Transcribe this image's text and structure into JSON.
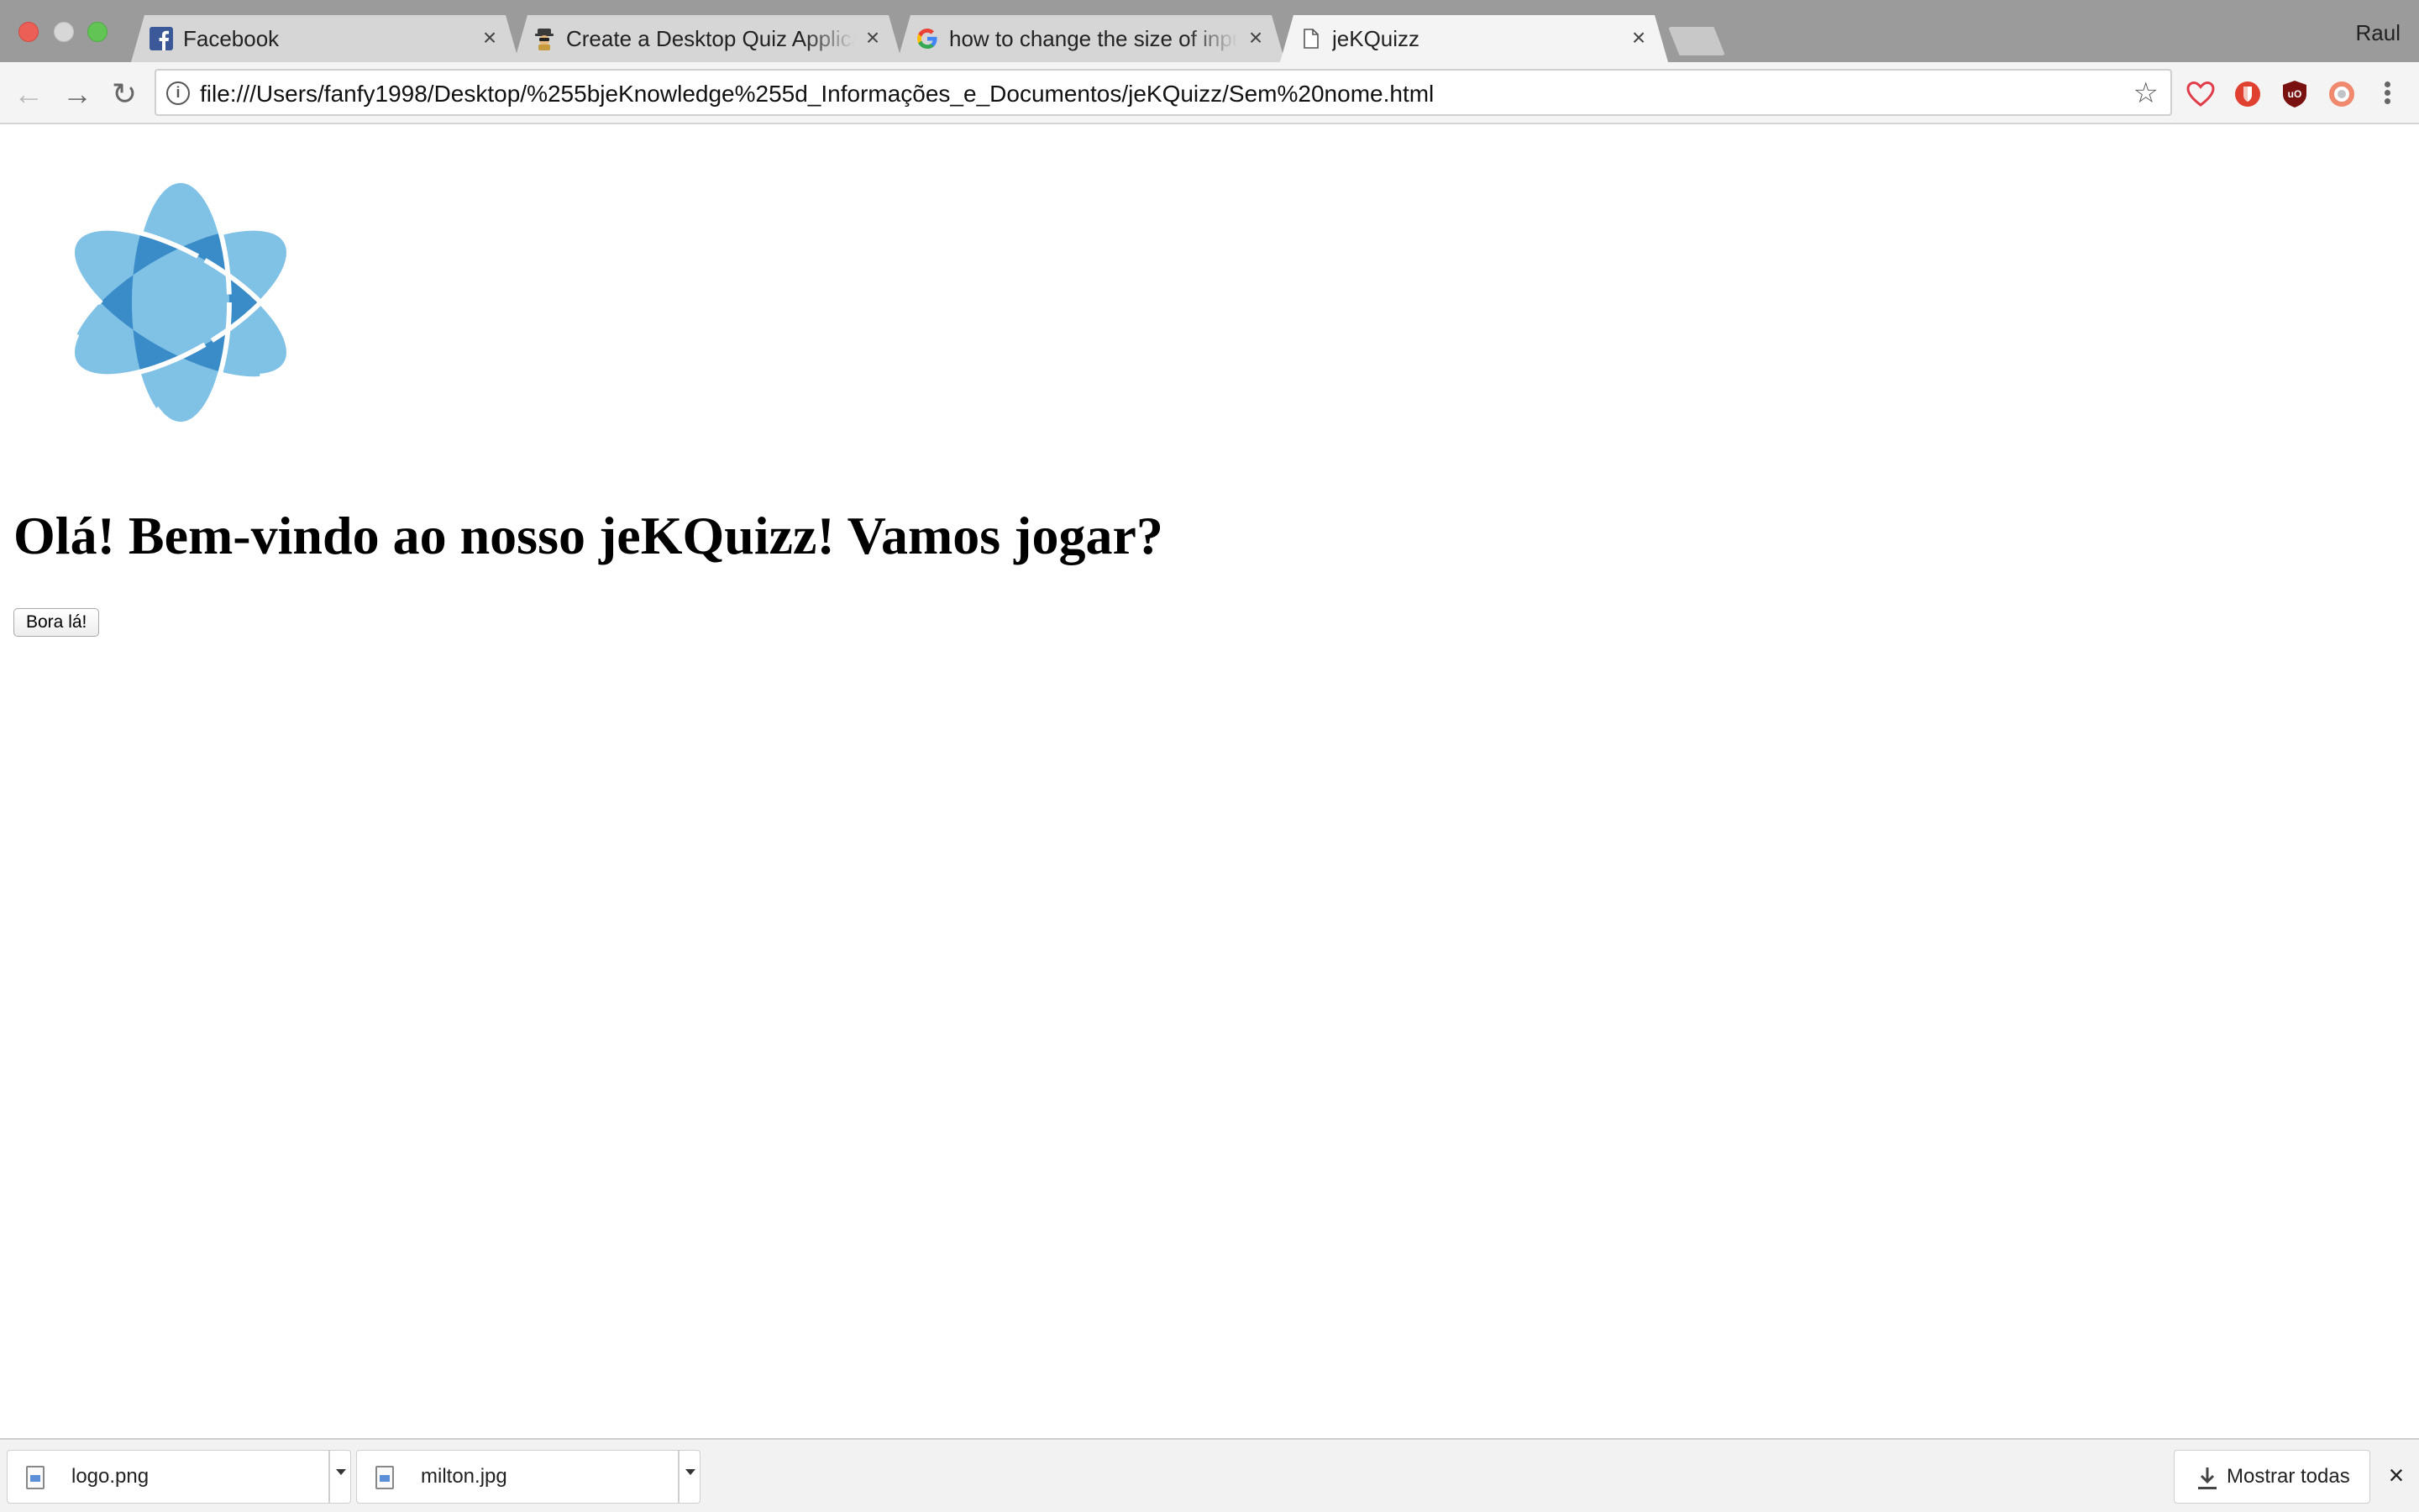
{
  "browser": {
    "profile_name": "Raul",
    "tabs": [
      {
        "title": "Facebook",
        "favicon": "facebook-icon",
        "active": false
      },
      {
        "title": "Create a Desktop Quiz Applica",
        "favicon": "spy-icon",
        "active": false
      },
      {
        "title": "how to change the size of inpu",
        "favicon": "google-icon",
        "active": false
      },
      {
        "title": "jeKQuizz",
        "favicon": "page-icon",
        "active": true
      }
    ],
    "address": {
      "url": "file:///Users/fanfy1998/Desktop/%255bjeKnowledge%255d_Informações_e_Documentos/jeKQuizz/Sem%20nome.html"
    },
    "colors": {
      "tabstrip": "#9b9b9b",
      "active_tab": "#f4f4f4",
      "inactive_tab": "#d6d6d6"
    }
  },
  "page": {
    "logo_icon": "atom-logo-icon",
    "heading": "Olá! Bem-vindo ao nosso jeKQuizz! Vamos jogar?",
    "start_button": "Bora lá!",
    "logo_colors": {
      "light": "#80c1e6",
      "dark": "#3a8cc9"
    }
  },
  "downloads": {
    "items": [
      {
        "filename": "logo.png"
      },
      {
        "filename": "milton.jpg"
      }
    ],
    "show_all": "Mostrar todas"
  }
}
